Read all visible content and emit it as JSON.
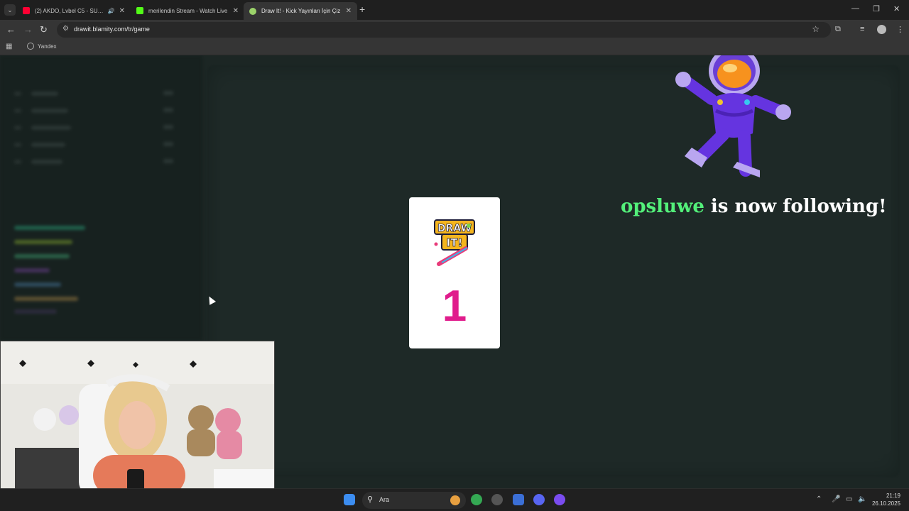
{
  "browser": {
    "tabs": [
      {
        "label": "(2) AKDO, Lvbel C5 - SUBM",
        "icon": "youtube-icon",
        "color": "#ff0033",
        "audio": true
      },
      {
        "label": "merilendin Stream - Watch Live",
        "icon": "kick-icon",
        "color": "#53fc18"
      },
      {
        "label": "Draw It! - Kick Yayınları İçin Çiz",
        "icon": "drawit-icon",
        "color": "#9bd36a",
        "active": true
      }
    ],
    "url": "drawit.blamity.com/tr/game",
    "bookmarks": [
      {
        "label": "Yandex"
      }
    ]
  },
  "game": {
    "card_number": "1",
    "logo_text": "DRAW IT!",
    "alert_username": "opsluwe",
    "alert_message": " is now following!",
    "alert_username_color": "#53f07a"
  },
  "taskbar": {
    "search_label": "Ara",
    "time": "21:19",
    "date": "26.10.2025"
  }
}
